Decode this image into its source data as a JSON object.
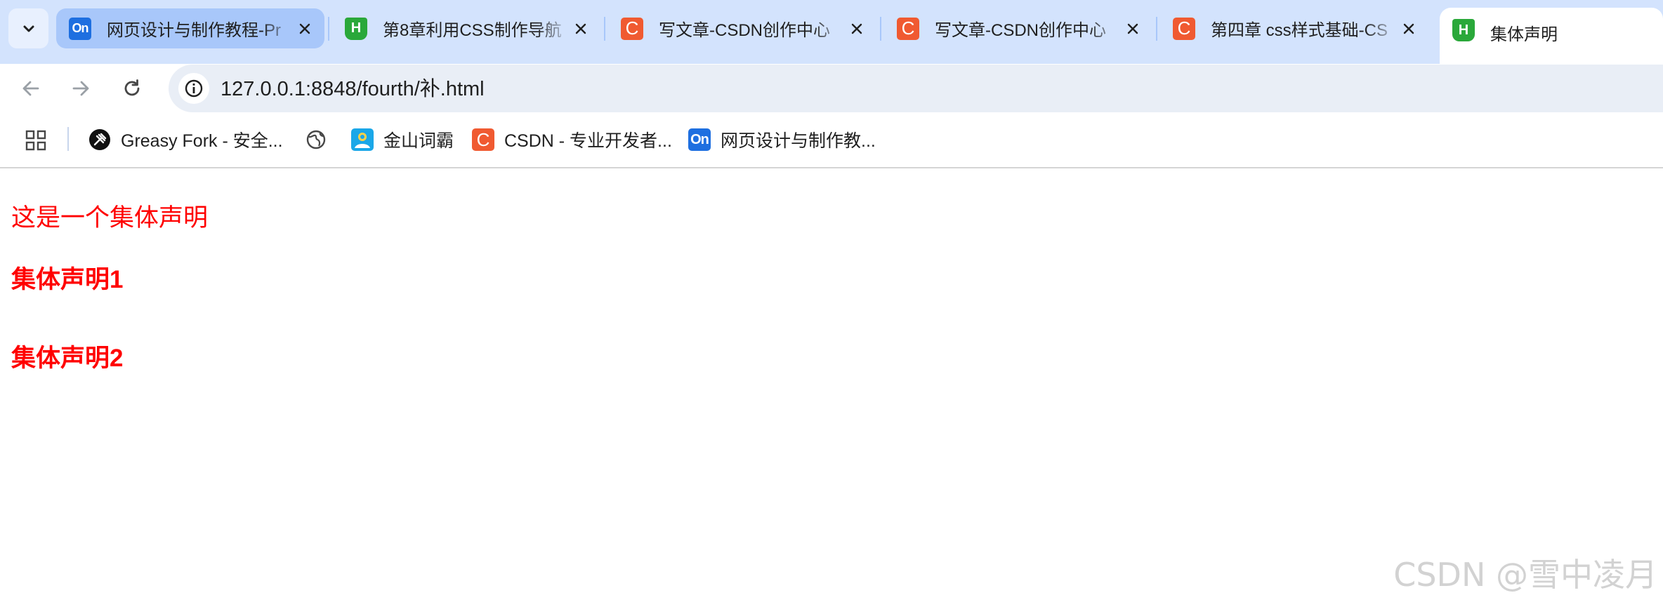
{
  "tabs": [
    {
      "title": "网页设计与制作教程-Pr",
      "favicon": "on-icon",
      "favicon_text": "On",
      "state": "hovered"
    },
    {
      "title": "第8章利用CSS制作导航",
      "favicon": "html-h-icon",
      "favicon_text": "H",
      "state": "normal"
    },
    {
      "title": "写文章-CSDN创作中心",
      "favicon": "csdn-c-icon",
      "favicon_text": "C",
      "state": "normal"
    },
    {
      "title": "写文章-CSDN创作中心",
      "favicon": "csdn-c-icon",
      "favicon_text": "C",
      "state": "normal"
    },
    {
      "title": "第四章 css样式基础-CS",
      "favicon": "csdn-c-icon",
      "favicon_text": "C",
      "state": "normal"
    },
    {
      "title": "集体声明",
      "favicon": "html-h-icon",
      "favicon_text": "H",
      "state": "active"
    }
  ],
  "address_bar": {
    "url": "127.0.0.1:8848/fourth/补.html"
  },
  "bookmarks": [
    {
      "label": "Greasy Fork - 安全...",
      "icon": "greasy-fork-icon"
    },
    {
      "label": "",
      "icon": "globe-icon"
    },
    {
      "label": "金山词霸",
      "icon": "iciba-icon"
    },
    {
      "label": "CSDN - 专业开发者...",
      "icon": "csdn-c-icon",
      "icon_text": "C"
    },
    {
      "label": "网页设计与制作教...",
      "icon": "on-icon",
      "icon_text": "On"
    }
  ],
  "page": {
    "intro": "这是一个集体声明",
    "heading1": "集体声明1",
    "heading2": "集体声明2",
    "text_color": "#ff0000"
  },
  "watermark": "CSDN @雪中凌月",
  "colors": {
    "tabstrip_bg": "#d3e3fd",
    "omnibox_bg": "#e9eef6",
    "csdn_orange": "#f05a31",
    "html_green": "#2aa83a",
    "on_blue": "#1e6fe0"
  }
}
